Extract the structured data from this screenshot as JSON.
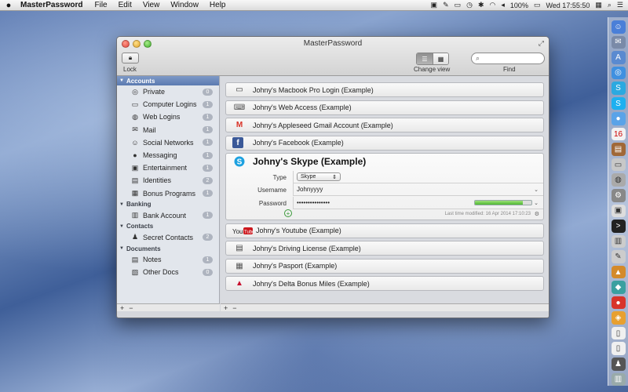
{
  "menubar": {
    "app_name": "MasterPassword",
    "menus": [
      "File",
      "Edit",
      "View",
      "Window",
      "Help"
    ],
    "battery": "100%",
    "clock": "Wed 17:55:50"
  },
  "window": {
    "title": "MasterPassword",
    "lock_label": "Lock",
    "change_view_label": "Change view",
    "find_label": "Find",
    "search_placeholder": "",
    "search_value": ""
  },
  "sidebar": {
    "sections": [
      {
        "title": "Accounts",
        "items": [
          {
            "label": "Private",
            "count": "0",
            "icon": "fingerprint-icon",
            "glyph": "◎"
          },
          {
            "label": "Computer Logins",
            "count": "1",
            "icon": "laptop-icon",
            "glyph": "▭"
          },
          {
            "label": "Web Logins",
            "count": "1",
            "icon": "globe-icon",
            "glyph": "◍"
          },
          {
            "label": "Mail",
            "count": "1",
            "icon": "mail-icon",
            "glyph": "✉"
          },
          {
            "label": "Social Networks",
            "count": "1",
            "icon": "people-icon",
            "glyph": "☺"
          },
          {
            "label": "Messaging",
            "count": "1",
            "icon": "chat-icon",
            "glyph": "●"
          },
          {
            "label": "Entertainment",
            "count": "1",
            "icon": "tv-icon",
            "glyph": "▣"
          },
          {
            "label": "Identities",
            "count": "2",
            "icon": "id-card-icon",
            "glyph": "▤"
          },
          {
            "label": "Bonus Programs",
            "count": "1",
            "icon": "gift-icon",
            "glyph": "▦"
          }
        ]
      },
      {
        "title": "Banking",
        "items": [
          {
            "label": "Bank Account",
            "count": "1",
            "icon": "bank-icon",
            "glyph": "▥"
          }
        ]
      },
      {
        "title": "Contacts",
        "items": [
          {
            "label": "Secret Contacts",
            "count": "2",
            "icon": "person-icon",
            "glyph": "♟"
          }
        ]
      },
      {
        "title": "Documents",
        "items": [
          {
            "label": "Notes",
            "count": "1",
            "icon": "notebook-icon",
            "glyph": "▤"
          },
          {
            "label": "Other Docs",
            "count": "0",
            "icon": "docs-icon",
            "glyph": "▧"
          }
        ]
      }
    ],
    "footer_add": "+",
    "footer_remove": "−"
  },
  "entries_top": [
    {
      "title": "Johny's Macbook Pro Login (Example)",
      "icon": "laptop-icon",
      "glyph": "▭",
      "color": "#333333"
    },
    {
      "title": "Johny's Web Access (Example)",
      "icon": "keyboard-icon",
      "glyph": "⌨",
      "color": "#555555"
    },
    {
      "title": "Johny's Appleseed Gmail Account (Example)",
      "icon": "gmail-icon",
      "glyph": "M",
      "color": "#d93025"
    },
    {
      "title": "Johny's Facebook (Example)",
      "icon": "facebook-icon",
      "glyph": "f",
      "color": "#3b5998"
    }
  ],
  "expanded_entry": {
    "title": "Johny's Skype (Example)",
    "icon": "skype-icon",
    "fields": {
      "type_label": "Type",
      "type_value": "Skype",
      "username_label": "Username",
      "username_value": "Johnyyyy",
      "password_label": "Password",
      "password_value": "•••••••••••••••",
      "password_strength": 0.85
    },
    "modified": "Last time modified: 16 Apr 2014 17:10:23"
  },
  "entries_bottom": [
    {
      "title": "Johny's Youtube (Example)",
      "icon": "youtube-icon",
      "glyph": "You",
      "color": "#cc181e"
    },
    {
      "title": "Johny's Driving License (Example)",
      "icon": "license-icon",
      "glyph": "▤",
      "color": "#444444"
    },
    {
      "title": "Johny's Pasport (Example)",
      "icon": "passport-icon",
      "glyph": "▦",
      "color": "#555555"
    },
    {
      "title": "Johny's Delta Bonus Miles (Example)",
      "icon": "delta-icon",
      "glyph": "▲",
      "color": "#c8102e"
    }
  ],
  "content_footer_add": "+",
  "content_footer_remove": "−"
}
